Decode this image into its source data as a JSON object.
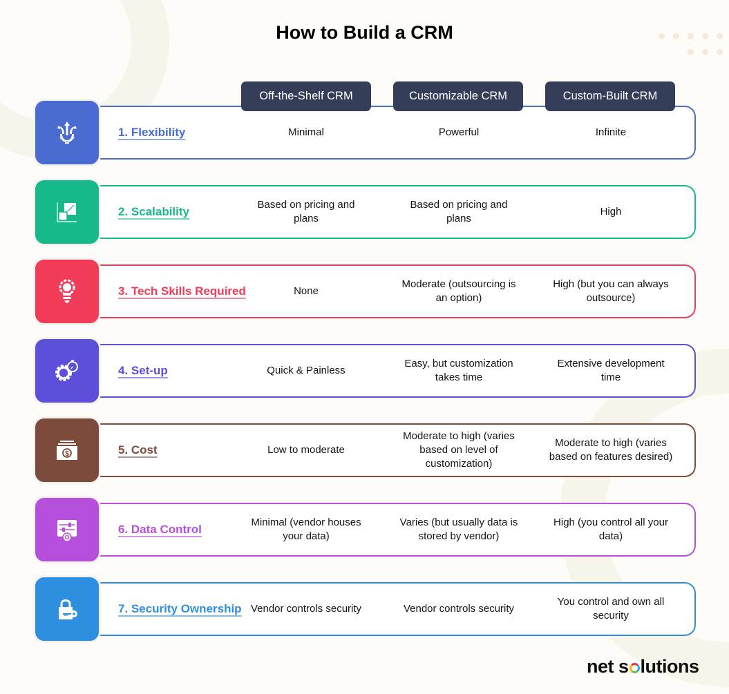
{
  "title": "How to Build a CRM",
  "columns": [
    "Off-the-Shelf CRM",
    "Customizable CRM",
    "Custom-Built CRM"
  ],
  "rows": [
    {
      "label": "1. Flexibility",
      "icon": "flexibility-trident-gear-icon",
      "color": "#4a6bd1",
      "values": [
        "Minimal",
        "Powerful",
        "Infinite"
      ]
    },
    {
      "label": "2. Scalability",
      "icon": "scale-squares-icon",
      "color": "#16b98a",
      "values": [
        "Based on pricing and plans",
        "Based on pricing and plans",
        "High"
      ]
    },
    {
      "label": "3. Tech Skills Required",
      "icon": "lightbulb-gear-icon",
      "color": "#f23b57",
      "values": [
        "None",
        "Moderate (outsourcing is an option)",
        "High (but you can always outsource)"
      ]
    },
    {
      "label": "4. Set-up",
      "icon": "gear-stopwatch-icon",
      "color": "#5c4fd9",
      "values": [
        "Quick & Painless",
        "Easy, but customization takes time",
        "Extensive development time"
      ]
    },
    {
      "label": "5. Cost",
      "icon": "money-bill-icon",
      "color": "#7d4b3c",
      "values": [
        "Low to moderate",
        "Moderate to high (varies based on level of customization)",
        "Moderate to high (varies based on features desired)"
      ]
    },
    {
      "label": "6. Data Control",
      "icon": "data-settings-icon",
      "color": "#b64fdc",
      "values": [
        "Minimal (vendor houses your data)",
        "Varies (but usually data is stored by vendor)",
        "High (you control all your data)"
      ]
    },
    {
      "label": "7. Security Ownership",
      "icon": "lock-key-icon",
      "color": "#2e8fe0",
      "values": [
        "Vendor controls security",
        "Vendor controls security",
        "You control and own all security"
      ]
    }
  ],
  "logo": {
    "part1": "net s",
    "part2": "lutions"
  },
  "colors": {
    "header_bg": "#343e59",
    "background": "#fdfcf8"
  }
}
